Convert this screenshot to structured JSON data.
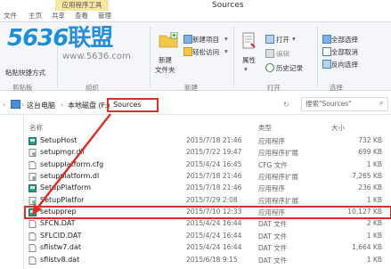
{
  "window": {
    "title": "Sources",
    "context_tab": "应用程序工具"
  },
  "ribbon_tabs": [
    "文件",
    "主页",
    "共享",
    "查看",
    "管理"
  ],
  "watermark": {
    "logo_digits": "5636",
    "logo_text": "联盟",
    "url": "www.5636.com"
  },
  "ribbon": {
    "clipboard": {
      "label": "剪贴板",
      "paste_shortcut": "粘贴快捷方式"
    },
    "organize": {
      "label": "组织"
    },
    "new": {
      "label": "新建",
      "new_item": "新建项目",
      "easy_access": "轻松访问",
      "new_folder_line1": "新建",
      "new_folder_line2": "文件夹"
    },
    "open": {
      "label": "打开",
      "properties": "属性",
      "open_btn": "打开",
      "edit": "编辑",
      "history": "历史记录"
    },
    "select": {
      "label": "选择",
      "select_all": "全部选择",
      "select_none": "全部取消",
      "invert": "反向选择"
    }
  },
  "address": {
    "crumbs": [
      "这台电脑",
      "本地磁盘 (F:)"
    ],
    "current": "Sources",
    "search_placeholder": "搜索\"Sources\""
  },
  "columns": {
    "name": "名称",
    "date": "",
    "type": "类型",
    "size": "大小"
  },
  "files": [
    {
      "name": "SetupHost",
      "date": "2015/7/18 21:46",
      "type": "应用程序",
      "size": "732 KB",
      "icon": "app-icon"
    },
    {
      "name": "setupmgr.dll",
      "date": "2015/7/22 19:47",
      "type": "应用程序扩展",
      "size": "699 KB",
      "icon": "dll-icon"
    },
    {
      "name": "setupplatform.cfg",
      "date": "2015/4/24 16:45",
      "type": "CFG 文件",
      "size": "1 KB",
      "icon": "file-icon"
    },
    {
      "name": "setupplatform.dl",
      "date": "2015/7/18 21:46",
      "type": "应用程序扩展",
      "size": "7,265 KB",
      "icon": "dll-icon"
    },
    {
      "name": "SetupPlatform",
      "date": "2015/7/18 21:46",
      "type": "应用程序",
      "size": "236 KB",
      "icon": "app-icon"
    },
    {
      "name": "SetupPlatfor",
      "date": "2015/7/29 2:08",
      "type": "应用程序扩展",
      "size": "1 KB",
      "icon": "dll-icon"
    },
    {
      "name": "setupprep",
      "date": "2015/7/10 12:33",
      "type": "应用程序",
      "size": "10,127 KB",
      "icon": "app-icon"
    },
    {
      "name": "SFCN.DAT",
      "date": "2015/4/24 16:44",
      "type": "DAT 文件",
      "size": "2 KB",
      "icon": "file-icon"
    },
    {
      "name": "SFLCID.DAT",
      "date": "2015/4/24 16:44",
      "type": "DAT 文件",
      "size": "1 KB",
      "icon": "file-icon"
    },
    {
      "name": "sflistw7.dat",
      "date": "2015/4/24 16:44",
      "type": "DAT 文件",
      "size": "1,664 KB",
      "icon": "file-icon"
    },
    {
      "name": "sflistv8.dat",
      "date": "2015/6/18 9:15",
      "type": "DAT 文件",
      "size": "1 KB",
      "icon": "file-icon"
    }
  ],
  "colors": {
    "highlight": "#d9302a",
    "accent": "#1e8fd6",
    "context_tab": "#f8e7a2"
  }
}
